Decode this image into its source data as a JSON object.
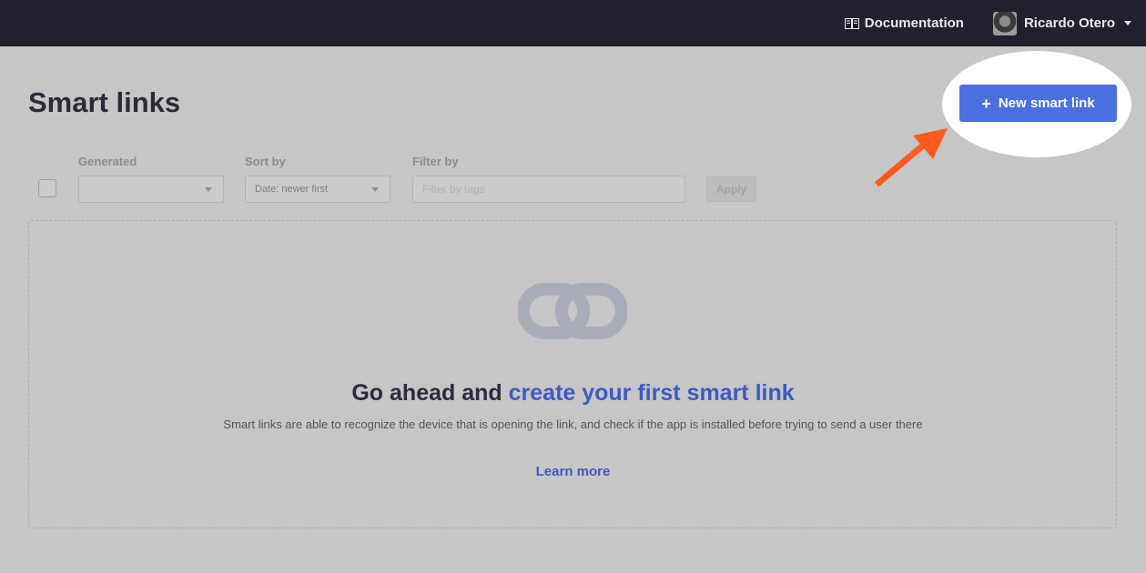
{
  "topbar": {
    "documentation_label": "Documentation",
    "user_name": "Ricardo Otero"
  },
  "page": {
    "title": "Smart links",
    "new_button_label": "New smart link"
  },
  "filters": {
    "generated_label": "Generated",
    "generated_value": "",
    "sort_label": "Sort by",
    "sort_value": "Date: newer first",
    "filter_label": "Filter by",
    "filter_placeholder": "Filter by tags",
    "apply_label": "Apply"
  },
  "empty_state": {
    "headline_prefix": "Go ahead and ",
    "headline_link": "create your first smart link",
    "description": "Smart links are able to recognize the device that is opening the link, and check if the app is installed before trying to send a user there",
    "learn_more": "Learn more"
  },
  "colors": {
    "topbar": "#21202d",
    "primary": "#4a6fe0",
    "accent_text": "#3d59c4",
    "annotation_arrow": "#ff5a1f",
    "overlay_bg": "#c6c6c6"
  }
}
